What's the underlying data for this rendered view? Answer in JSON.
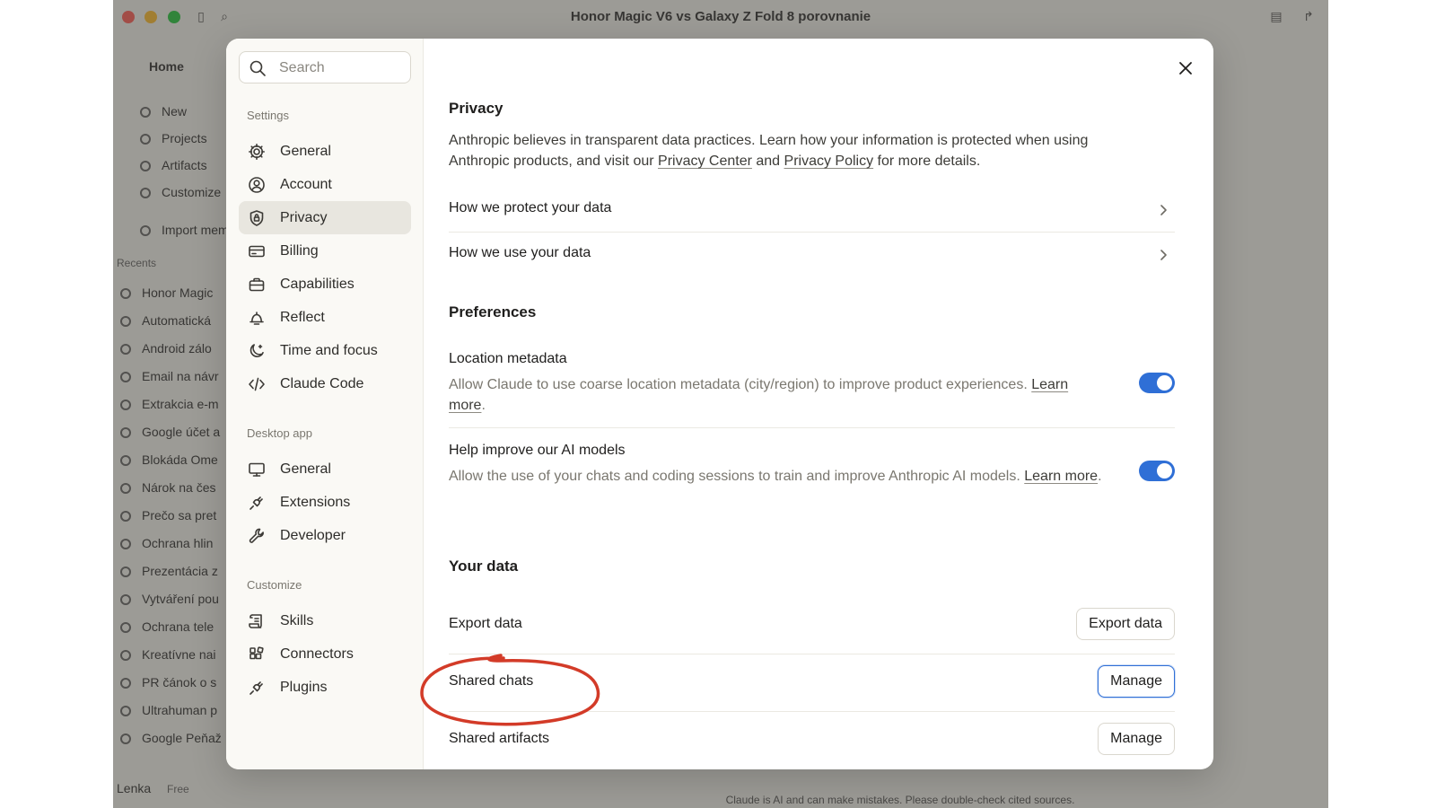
{
  "app": {
    "title": "Honor Magic V6 vs Galaxy Z Fold 8 porovnanie",
    "home_label": "Home",
    "sidebar_items": [
      "New",
      "Projects",
      "Artifacts",
      "Customize",
      "Import memo"
    ],
    "recents_label": "Recents",
    "recents": [
      "Honor Magic",
      "Automatická",
      "Android zálo",
      "Email na návr",
      "Extrakcia e-m",
      "Google účet a",
      "Blokáda Ome",
      "Nárok na čes",
      "Prečo sa pret",
      "Ochrana hlin",
      "Prezentácia z",
      "Vytváření pou",
      "Ochrana tele",
      "Kreatívne nai",
      "PR čánok o s",
      "Ultrahuman p",
      "Google Peňaž"
    ],
    "user_name": "Lenka",
    "user_plan": "Free",
    "footer_note": "Claude is AI and can make mistakes. Please double-check cited sources."
  },
  "search": {
    "placeholder": "Search"
  },
  "nav": {
    "settings_label": "Settings",
    "settings_items": [
      {
        "label": "General",
        "icon": "gear-icon"
      },
      {
        "label": "Account",
        "icon": "user-circle-icon"
      },
      {
        "label": "Privacy",
        "icon": "shield-lock-icon"
      },
      {
        "label": "Billing",
        "icon": "credit-card-icon"
      },
      {
        "label": "Capabilities",
        "icon": "briefcase-icon"
      },
      {
        "label": "Reflect",
        "icon": "bell-icon"
      },
      {
        "label": "Time and focus",
        "icon": "moon-sparkle-icon"
      },
      {
        "label": "Claude Code",
        "icon": "code-icon"
      }
    ],
    "desktop_label": "Desktop app",
    "desktop_items": [
      {
        "label": "General",
        "icon": "monitor-icon"
      },
      {
        "label": "Extensions",
        "icon": "plug-icon"
      },
      {
        "label": "Developer",
        "icon": "wrench-icon"
      }
    ],
    "customize_label": "Customize",
    "customize_items": [
      {
        "label": "Skills",
        "icon": "scroll-icon"
      },
      {
        "label": "Connectors",
        "icon": "blocks-icon"
      },
      {
        "label": "Plugins",
        "icon": "plug-icon"
      }
    ]
  },
  "privacy": {
    "title": "Privacy",
    "intro_1": "Anthropic believes in transparent data practices. Learn how your information is protected when using Anthropic products, and visit our ",
    "privacy_center_link": "Privacy Center",
    "intro_and": " and ",
    "privacy_policy_link": "Privacy Policy",
    "intro_2": " for more details.",
    "protect_row": "How we protect your data",
    "use_row": "How we use your data"
  },
  "preferences": {
    "title": "Preferences",
    "location": {
      "label": "Location metadata",
      "desc": "Allow Claude to use coarse location metadata (city/region) to improve product experiences. ",
      "link": "Learn more",
      "suffix": ".",
      "enabled": true
    },
    "improve": {
      "label": "Help improve our AI models",
      "desc": "Allow the use of your chats and coding sessions to train and improve Anthropic AI models. ",
      "link": "Learn more",
      "suffix": ".",
      "enabled": true
    }
  },
  "your_data": {
    "title": "Your data",
    "export_label": "Export data",
    "export_button": "Export data",
    "shared_chats_label": "Shared chats",
    "shared_chats_button": "Manage",
    "shared_artifacts_label": "Shared artifacts",
    "shared_artifacts_button": "Manage"
  },
  "colors": {
    "accent": "#2f6fd6",
    "annotation": "#d33b28",
    "active_nav": "#e8e6df"
  }
}
